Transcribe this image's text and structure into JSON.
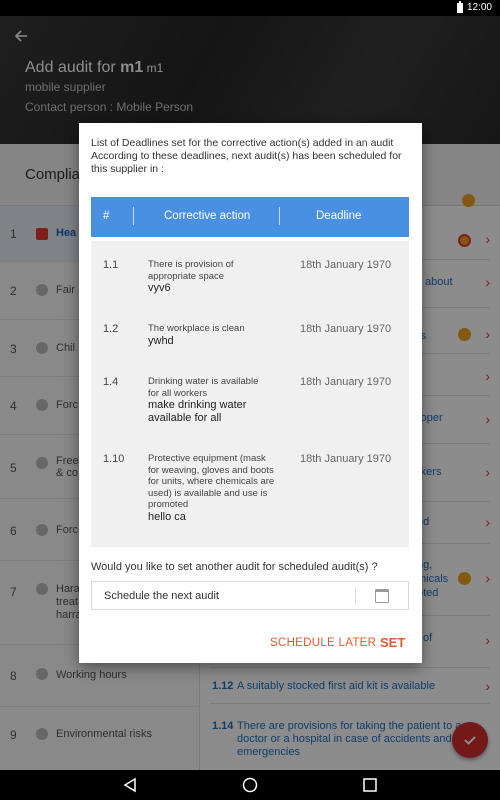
{
  "status_bar": {
    "time": "12:00"
  },
  "header": {
    "title_prefix": "Add audit for ",
    "title_bold": "m1",
    "title_tag": " m1",
    "supplier_type": "mobile supplier",
    "contact": "Contact person : Mobile Person"
  },
  "background": {
    "compliance_label": "Complia",
    "left_items": [
      {
        "num": "1",
        "label": "Hea"
      },
      {
        "num": "2",
        "label": "Fair"
      },
      {
        "num": "3",
        "label": "Chil"
      },
      {
        "num": "4",
        "label": "Forc"
      },
      {
        "num": "5",
        "label": "Free\n& co"
      },
      {
        "num": "6",
        "label": "Forc"
      },
      {
        "num": "7",
        "label": "Hara\ntreat\nharra"
      },
      {
        "num": "8",
        "label": "Working hours"
      },
      {
        "num": "9",
        "label": "Environmental risks"
      }
    ],
    "right_rows": [
      {
        "text": "about"
      },
      {
        "text": "rs"
      },
      {
        "text": "roper"
      },
      {
        "text": "rkers"
      },
      {
        "text": "ed"
      },
      {
        "text": "ng,\nmicals\noted"
      },
      {
        "text": "of"
      },
      {
        "num": "1.12",
        "text": "A suitably stocked first aid kit is available"
      },
      {
        "num": "1.14",
        "text": "There are provisions for taking the patient to a doctor or a hospital in case of accidents and emergencies"
      }
    ],
    "colors": {
      "accent_orange": "#f0a020",
      "accent_red": "#e53935",
      "link_blue": "#1e6fbf"
    }
  },
  "dialog": {
    "intro": "List of Deadlines set for the corrective action(s) added in an audit\nAccording to these deadlines, next audit(s) has been scheduled for this supplier in :",
    "columns": {
      "num": "#",
      "action": "Corrective action",
      "deadline": "Deadline"
    },
    "rows": [
      {
        "num": "1.1",
        "action": "There is provision of appropriate space",
        "detail": "vyv6",
        "deadline": "18th January 1970"
      },
      {
        "num": "1.2",
        "action": "The workplace is clean",
        "detail": "ywhd",
        "deadline": "18th January 1970"
      },
      {
        "num": "1.4",
        "action": "Drinking water is available for all workers",
        "detail": "make drinking water available for all",
        "deadline": "18th January 1970"
      },
      {
        "num": "1.10",
        "action": "Protective equipment (mask for weaving, gloves and boots for units, where chemicals are used) is available and use is promoted",
        "detail": "hello ca",
        "deadline": "18th January 1970"
      }
    ],
    "question": "Would you like to set another audit for scheduled audit(s) ?",
    "input_value": "Schedule the next audit",
    "btn_later": "SCHEDULE LATER",
    "btn_set": "SET",
    "header_color": "#4a90e2",
    "button_color": "#e05a2f"
  }
}
